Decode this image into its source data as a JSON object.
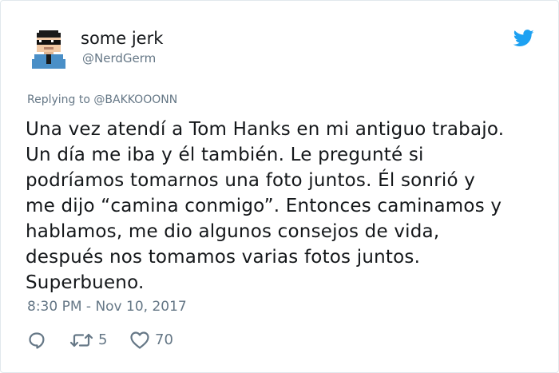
{
  "tweet": {
    "author": {
      "display_name": "some jerk",
      "handle": "@NerdGerm",
      "avatar_icon": "pixel-art-avatar-with-sunglasses"
    },
    "replying_label": "Replying to",
    "replying_handle": "@BAKKOOONN",
    "text_lines": [
      "Una vez atendí a Tom Hanks en mi antiguo trabajo.",
      "Un día me iba y él también. Le pregunté si",
      "podríamos tomarnos una foto juntos. Él sonrió y",
      "me dijo “camina conmigo”. Entonces caminamos y",
      "hablamos, me dio algunos consejos de vida,",
      "después nos tomamos varias fotos juntos.",
      "Superbueno."
    ],
    "timestamp": "8:30 PM - Nov 10, 2017",
    "actions": {
      "reply_icon": "reply-bubble-icon",
      "retweet_icon": "retweet-arrows-icon",
      "retweet_count": "5",
      "like_icon": "heart-outline-icon",
      "like_count": "70"
    }
  },
  "colors": {
    "text": "#14171a",
    "secondary": "#657786",
    "brand_blue": "#1da1f2",
    "border": "#e1e8ed"
  }
}
